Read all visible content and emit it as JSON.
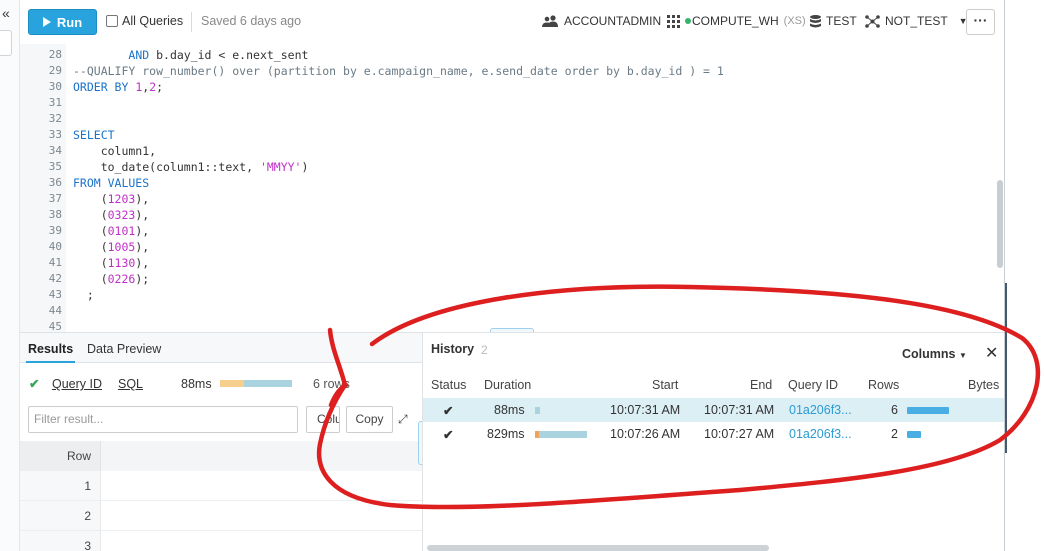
{
  "toolbar": {
    "run_label": "Run",
    "all_queries_label": "All Queries",
    "saved_label": "Saved 6 days ago",
    "role": "ACCOUNTADMIN",
    "warehouse": "COMPUTE_WH",
    "warehouse_size": "(XS)",
    "database": "TEST",
    "schema": "NOT_TEST",
    "more_label": "···"
  },
  "editor": {
    "lines": [
      {
        "n": "28",
        "html": "        <span class=\"kw\">AND</span> b.day_id &lt; e.next_sent"
      },
      {
        "n": "29",
        "html": "<span class=\"cm\">--QUALIFY row_number() over (partition by e.campaign_name, e.send_date order by b.day_id ) = 1</span>"
      },
      {
        "n": "30",
        "html": "<span class=\"kw\">ORDER BY</span> <span class=\"nm\">1</span>,<span class=\"nm\">2</span>;"
      },
      {
        "n": "31",
        "html": ""
      },
      {
        "n": "32",
        "html": ""
      },
      {
        "n": "33",
        "html": "<span class=\"kw\">SELECT</span>"
      },
      {
        "n": "34",
        "html": "    column1,"
      },
      {
        "n": "35",
        "html": "    to_date(column1::text, <span class=\"st\">'MMYY'</span>)"
      },
      {
        "n": "36",
        "html": "<span class=\"kw\">FROM VALUES</span>"
      },
      {
        "n": "37",
        "html": "    (<span class=\"nm\">1203</span>),"
      },
      {
        "n": "38",
        "html": "    (<span class=\"nm\">0323</span>),"
      },
      {
        "n": "39",
        "html": "    (<span class=\"nm\">0101</span>),"
      },
      {
        "n": "40",
        "html": "    (<span class=\"nm\">1005</span>),"
      },
      {
        "n": "41",
        "html": "    (<span class=\"nm\">1130</span>),"
      },
      {
        "n": "42",
        "html": "    (<span class=\"nm\">0226</span>);"
      },
      {
        "n": "43",
        "html": "  ;"
      },
      {
        "n": "44",
        "html": ""
      },
      {
        "n": "45",
        "html": ""
      }
    ]
  },
  "results": {
    "tab_results": "Results",
    "tab_preview": "Data Preview",
    "query_id_label": "Query ID",
    "sql_label": "SQL",
    "duration": "88ms",
    "duration_fraction": 0.33,
    "rows_label": "6 rows",
    "filter_placeholder": "Filter result...",
    "columns_label": "Columns",
    "copy_label": "Copy",
    "row_header": "Row",
    "rows": [
      "1",
      "2",
      "3"
    ]
  },
  "history": {
    "title": "History",
    "count": "2",
    "columns_label": "Columns",
    "headers": {
      "status": "Status",
      "duration": "Duration",
      "start": "Start",
      "end": "End",
      "query_id": "Query ID",
      "rows": "Rows",
      "bytes": "Bytes"
    },
    "entries": [
      {
        "duration": "88ms",
        "duration_fraction": 0.09,
        "start": "10:07:31 AM",
        "end": "10:07:31 AM",
        "query_id": "01a206f3...",
        "rows": "6",
        "rows_fraction": 1.0
      },
      {
        "duration": "829ms",
        "duration_fraction": 1.0,
        "start": "10:07:26 AM",
        "end": "10:07:27 AM",
        "query_id": "01a206f3...",
        "rows": "2",
        "rows_fraction": 0.33
      }
    ]
  },
  "colors": {
    "accent": "#29a3dd",
    "success": "#34a853",
    "annotation": "#dd1f1f"
  }
}
